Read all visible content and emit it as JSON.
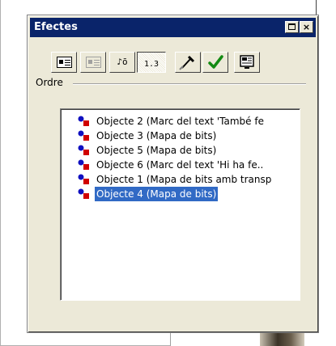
{
  "window": {
    "title": "Efectes",
    "maximize_label": "",
    "close_label": "×"
  },
  "toolbar": {
    "buttons": [
      {
        "name": "effect-list-button",
        "icon": "list-effect-icon",
        "state": "normal"
      },
      {
        "name": "effect-list-disabled-button",
        "icon": "list-effect-icon",
        "state": "disabled"
      },
      {
        "name": "sound-effect-button",
        "icon": "sound-effect-icon",
        "glyph": "♪ō",
        "state": "normal"
      },
      {
        "name": "order-button",
        "icon": "order-icon",
        "glyph": "1.3",
        "state": "active"
      },
      {
        "name": "eyedropper-button",
        "icon": "eyedropper-icon",
        "state": "normal"
      },
      {
        "name": "apply-button",
        "icon": "checkmark-icon",
        "state": "normal"
      },
      {
        "name": "preview-button",
        "icon": "preview-screen-icon",
        "state": "normal"
      }
    ]
  },
  "section": {
    "label": "Ordre"
  },
  "list": {
    "items": [
      {
        "label": "Objecte 2 (Marc del text 'També fe",
        "selected": false
      },
      {
        "label": "Objecte 3 (Mapa de bits)",
        "selected": false
      },
      {
        "label": "Objecte 5 (Mapa de bits)",
        "selected": false
      },
      {
        "label": "Objecte 6 (Marc del text 'Hi ha fe..",
        "selected": false
      },
      {
        "label": "Objecte 1 (Mapa de bits amb transp",
        "selected": false
      },
      {
        "label": "Objecte 4 (Mapa de bits)",
        "selected": true
      }
    ]
  },
  "colors": {
    "titlebar": "#0a246a",
    "selection": "#316ac5",
    "dialog_face": "#ece9d8",
    "icon_blue": "#1010c0",
    "icon_red": "#d00000",
    "check_green": "#138a13"
  }
}
